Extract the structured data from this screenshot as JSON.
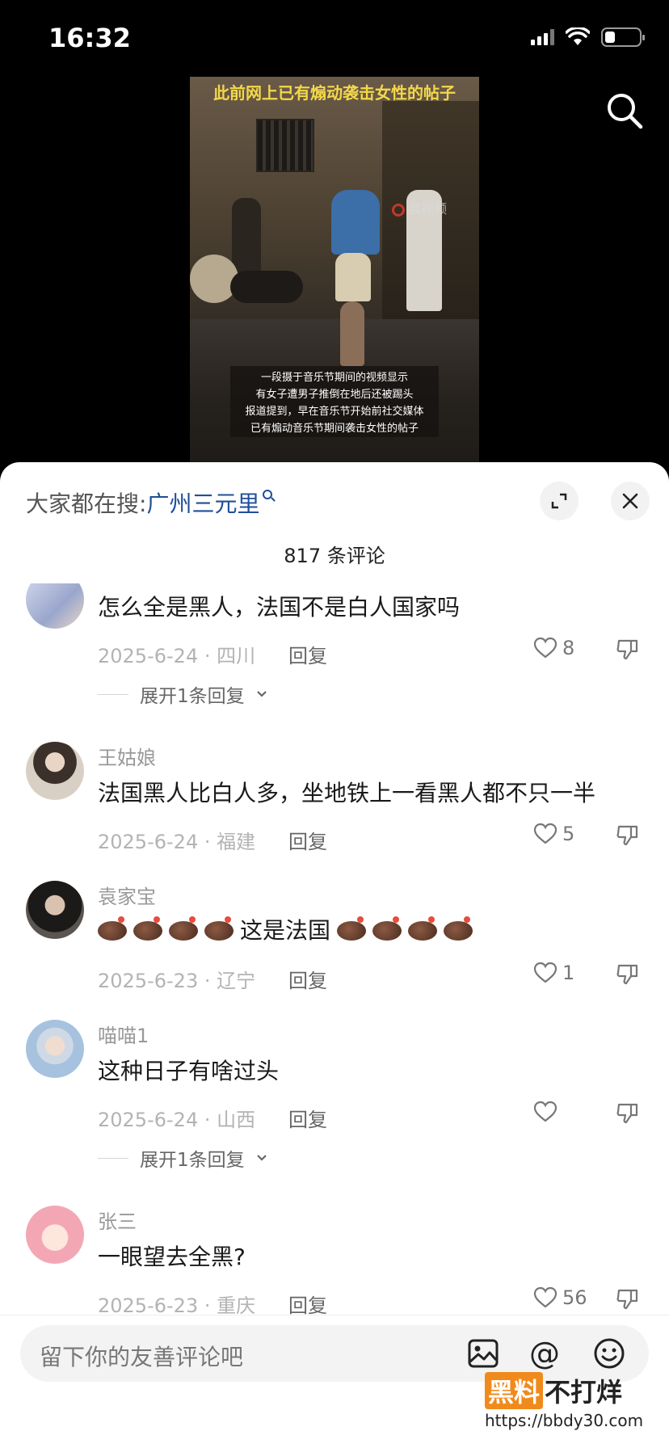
{
  "status_bar": {
    "time": "16:32"
  },
  "video": {
    "top_caption": "此前网上已有煽动袭击女性的帖子",
    "watermark": "晨视频",
    "bottom_caption": [
      "一段摄于音乐节期间的视频显示",
      "有女子遭男子推倒在地后还被踢头",
      "报道提到，早在音乐节开始前社交媒体",
      "已有煽动音乐节期间袭击女性的帖子"
    ]
  },
  "sheet": {
    "hot_search_label": "大家都在搜:",
    "hot_search_keyword": "广州三元里",
    "comment_count": "817 条评论"
  },
  "comments": [
    {
      "user": "",
      "text": "怎么全是黑人，法国不是白人国家吗",
      "date_loc": "2025-6-24 · 四川",
      "reply": "回复",
      "likes": "8",
      "expand": "展开1条回复"
    },
    {
      "user": "王姑娘",
      "text": "法国黑人比白人多，坐地铁上一看黑人都不只一半",
      "date_loc": "2025-6-24 · 福建",
      "reply": "回复",
      "likes": "5"
    },
    {
      "user": "袁家宝",
      "text_mid": "这是法国",
      "date_loc": "2025-6-23 · 辽宁",
      "reply": "回复",
      "likes": "1"
    },
    {
      "user": "喵喵1",
      "text": "这种日子有啥过头",
      "date_loc": "2025-6-24 · 山西",
      "reply": "回复",
      "likes": "",
      "expand": "展开1条回复"
    },
    {
      "user": "张三",
      "text": "一眼望去全黑?",
      "date_loc": "2025-6-23 · 重庆",
      "reply": "回复",
      "likes": "56"
    }
  ],
  "input": {
    "placeholder": "留下你的友善评论吧"
  },
  "site_watermark": {
    "logo_tag": "黑料",
    "logo_text": "不打烊",
    "url": "https://bbdy30.com"
  },
  "icons": [
    "search-icon",
    "expand-icon",
    "close-icon",
    "heart-icon",
    "dislike-icon",
    "chevron-down-icon",
    "image-icon",
    "at-icon",
    "emoji-icon"
  ]
}
